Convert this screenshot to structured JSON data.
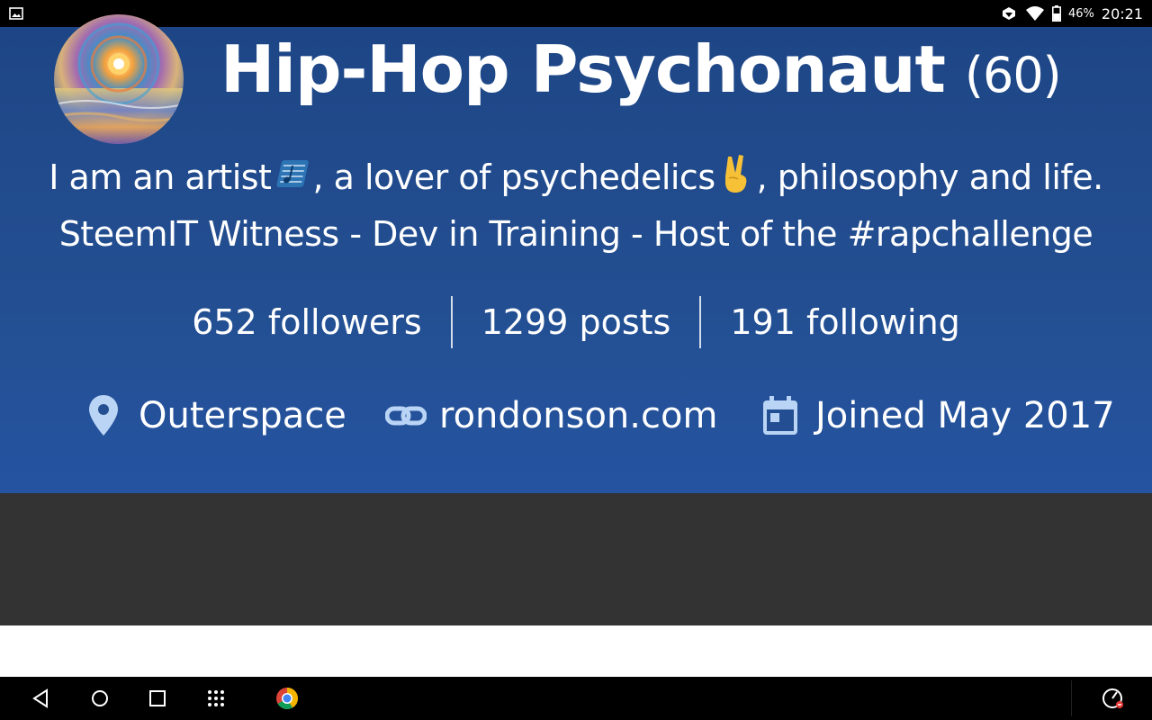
{
  "status_bar": {
    "battery": "46%",
    "time": "20:21"
  },
  "profile": {
    "name": "Hip-Hop Psychonaut",
    "reputation": "(60)",
    "about_line1_a": "I am an artist",
    "about_line1_b": ", a lover of psychedelics",
    "about_line1_c": ", philosophy and life.",
    "about_line2": "SteemIT Witness - Dev in Training - Host of the #rapchallenge",
    "stats": {
      "followers": "652 followers",
      "posts": "1299 posts",
      "following": "191 following"
    },
    "location": "Outerspace",
    "website": "rondonson.com",
    "joined": "Joined May 2017"
  },
  "icons": {
    "status_left": "image-icon",
    "status_right": [
      "data-saver-icon",
      "wifi-icon",
      "battery-icon"
    ],
    "about": [
      "music-notes-emoji",
      "victory-hand-emoji"
    ],
    "meta": [
      "location-pin-icon",
      "link-icon",
      "calendar-icon"
    ],
    "nav": [
      "back-icon",
      "home-icon",
      "recents-icon",
      "apps-icon",
      "chrome-icon",
      "speed-icon"
    ]
  },
  "colors": {
    "header_bg": "#234f92",
    "dark_band": "#333333",
    "icon_blue": "#b9d4f4"
  }
}
